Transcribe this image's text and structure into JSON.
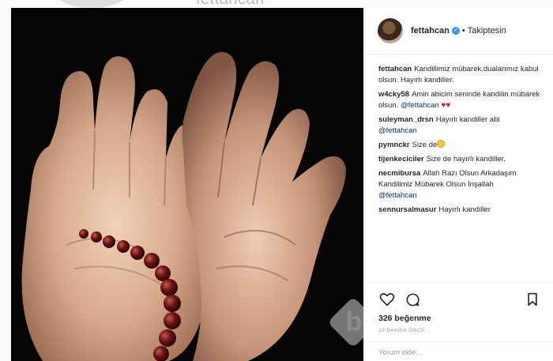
{
  "background": {
    "ghost_username": "fettahcan"
  },
  "post": {
    "author": "fettahcan",
    "follow_status": "Takiptesin",
    "separator": "•",
    "likes": "326 beğenme",
    "time_ago": "10 DAKİKA ÖNCE",
    "comment_placeholder": "Yorum ekle..."
  },
  "comments": [
    {
      "user": "fettahcan",
      "text": "Kandillimiz mübarek.dualarımız kabul olsun. Hayırlı kandiller."
    },
    {
      "user": "w4cky58",
      "text": "Amin abicim seninde kandilin mübarek olsun.",
      "mention": "@fettahcan",
      "suffix": "♥♥"
    },
    {
      "user": "suleyman_drsn",
      "text": "Hayırlı kandiller abi",
      "mention": "@fettahcan"
    },
    {
      "user": "pymnckr",
      "text": "Size de"
    },
    {
      "user": "tijenkeciciler",
      "text": "Size de hayırlı kandiller."
    },
    {
      "user": "necmibursa",
      "text": "Allah Razı Olsun Arkadaşım Kandilimiz Mübarek Olsun İnşallah",
      "mention": "@fettahcan"
    },
    {
      "user": "sennursalmasur",
      "text": "Hayırlı kandiller"
    }
  ],
  "watermark": "b",
  "colors": {
    "mention": "#003569",
    "verified": "#3897f0",
    "heart": "#d8183a"
  },
  "icons": [
    "heart-outline-icon",
    "comment-bubble-icon",
    "bookmark-icon",
    "verified-badge-icon",
    "smiling-emoji-icon"
  ]
}
